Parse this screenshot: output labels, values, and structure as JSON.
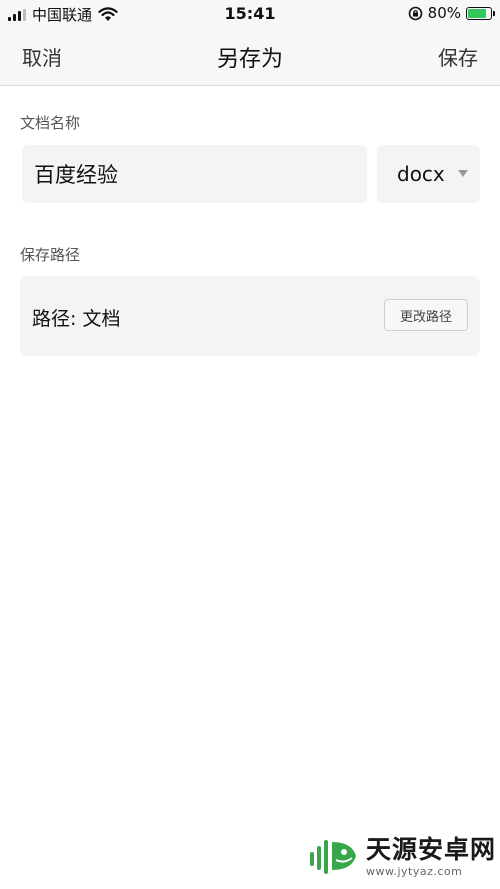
{
  "status_bar": {
    "carrier": "中国联通",
    "time": "15:41",
    "battery_percent_label": "80%",
    "battery_level": 0.8
  },
  "nav": {
    "cancel_label": "取消",
    "title": "另存为",
    "save_label": "保存"
  },
  "document": {
    "name_label": "文档名称",
    "name_value": "百度经验",
    "format_value": "docx"
  },
  "save_path": {
    "label": "保存路径",
    "path_text": "路径: 文档",
    "change_button_label": "更改路径"
  },
  "watermark": {
    "title": "天源安卓网",
    "url": "www.jytyaz.com"
  },
  "colors": {
    "bar_background": "#f7f7f7",
    "field_background": "#f4f4f4",
    "battery_green": "#34c759",
    "watermark_green": "#3aa64a"
  },
  "icons": [
    "signal-icon",
    "wifi-icon",
    "rotation-lock-icon",
    "battery-icon",
    "caret-down-icon"
  ]
}
